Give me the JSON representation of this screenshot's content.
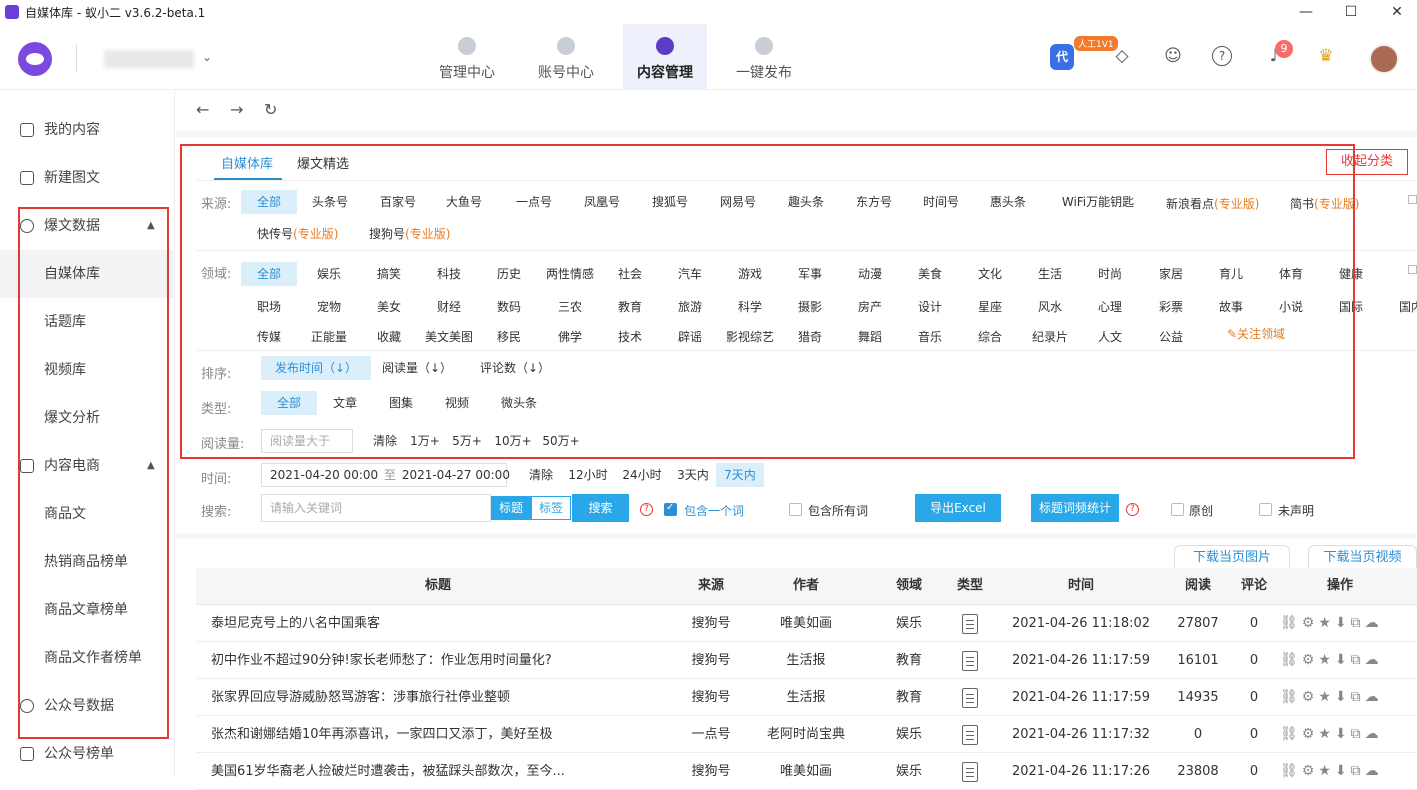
{
  "window": {
    "title": "自媒体库 - 蚁小二 v3.6.2-beta.1",
    "minimize": "—",
    "maximize": "☐",
    "close": "✕"
  },
  "header": {
    "nav": [
      {
        "label": "管理中心",
        "icon": "monitor-icon"
      },
      {
        "label": "账号中心",
        "icon": "account-icon"
      },
      {
        "label": "内容管理",
        "icon": "content-icon",
        "active": true
      },
      {
        "label": "一键发布",
        "icon": "publish-icon"
      }
    ],
    "vip_label": "代",
    "vip_tag": "人工1V1",
    "notif_count": "9",
    "icons": {
      "tag": "◇",
      "robot": "☺",
      "help": "?",
      "bell": "♪",
      "crown": "♛"
    }
  },
  "sidebar": {
    "items": [
      {
        "label": "我的内容",
        "icon": "document-icon"
      },
      {
        "label": "新建图文",
        "icon": "new-post-icon"
      },
      {
        "label": "爆文数据",
        "icon": "fire-icon",
        "expanded": true,
        "arrow": "▲"
      },
      {
        "label": "自媒体库",
        "active": true
      },
      {
        "label": "话题库"
      },
      {
        "label": "视频库"
      },
      {
        "label": "爆文分析"
      },
      {
        "label": "内容电商",
        "icon": "shop-icon",
        "expanded": true,
        "arrow": "▲"
      },
      {
        "label": "商品文"
      },
      {
        "label": "热销商品榜单"
      },
      {
        "label": "商品文章榜单"
      },
      {
        "label": "商品文作者榜单"
      },
      {
        "label": "公众号数据",
        "icon": "wechat-icon"
      },
      {
        "label": "公众号榜单",
        "icon": "trophy-icon"
      }
    ]
  },
  "toolbar": {
    "back": "←",
    "forward": "→",
    "refresh": "↻"
  },
  "filters": {
    "tabs": [
      "自媒体库",
      "爆文精选"
    ],
    "collapse_button": "收起分类",
    "source_label": "来源:",
    "sources_row1": [
      "全部",
      "头条号",
      "百家号",
      "大鱼号",
      "一点号",
      "凤凰号",
      "搜狐号",
      "网易号",
      "趣头条",
      "东方号",
      "时间号",
      "惠头条",
      "WiFi万能钥匙"
    ],
    "sources_pro": [
      {
        "name": "新浪看点",
        "tag": "(专业版)"
      },
      {
        "name": "简书",
        "tag": "(专业版)"
      },
      {
        "name": "快传号",
        "tag": "(专业版)"
      },
      {
        "name": "搜狗号",
        "tag": "(专业版)"
      }
    ],
    "field_label": "领域:",
    "fields_row1": [
      "全部",
      "娱乐",
      "搞笑",
      "科技",
      "历史",
      "两性情感",
      "社会",
      "汽车",
      "游戏",
      "军事",
      "动漫",
      "美食",
      "文化",
      "生活",
      "时尚",
      "家居",
      "育儿",
      "体育",
      "健康"
    ],
    "fields_row2": [
      "职场",
      "宠物",
      "美女",
      "财经",
      "数码",
      "三农",
      "教育",
      "旅游",
      "科学",
      "摄影",
      "房产",
      "设计",
      "星座",
      "风水",
      "心理",
      "彩票",
      "故事",
      "小说",
      "国际",
      "国内"
    ],
    "fields_row3": [
      "传媒",
      "正能量",
      "收藏",
      "美文美图",
      "移民",
      "佛学",
      "技术",
      "辟谣",
      "影视综艺",
      "猎奇",
      "舞蹈",
      "音乐",
      "综合",
      "纪录片",
      "人文",
      "公益"
    ],
    "follow_field": "✎关注领域",
    "sort_label": "排序:",
    "sorts": [
      "发布时间（↓）",
      "阅读量（↓）",
      "评论数（↓）"
    ],
    "type_label": "类型:",
    "types": [
      "全部",
      "文章",
      "图集",
      "视频",
      "微头条"
    ],
    "reads_label": "阅读量:",
    "reads_placeholder": "阅读量大于",
    "reads_opts": [
      "清除",
      "1万+",
      "5万+",
      "10万+",
      "50万+"
    ],
    "time_label": "时间:",
    "date_from": "2021-04-20 00:00",
    "date_to_sep": "至",
    "date_to": "2021-04-27 00:00",
    "time_opts": [
      "清除",
      "12小时",
      "24小时",
      "3天内",
      "7天内"
    ],
    "search_label": "搜索:",
    "search_placeholder": "请输入关键词",
    "search_scope": [
      "标题",
      "标签"
    ],
    "search_button": "搜索",
    "check_one": "包含一个词",
    "check_all": "包含所有词",
    "export_button": "导出Excel",
    "freq_button": "标题词频统计",
    "original": "原创",
    "undeclared": "未声明",
    "download_images": "下载当页图片",
    "download_videos": "下载当页视频"
  },
  "table": {
    "headers": [
      "标题",
      "来源",
      "作者",
      "领域",
      "类型",
      "时间",
      "阅读",
      "评论",
      "操作"
    ],
    "rows": [
      {
        "title": "泰坦尼克号上的八名中国乘客",
        "source": "搜狗号",
        "author": "唯美如画",
        "field": "娱乐",
        "time": "2021-04-26 11:18:02",
        "reads": "27807",
        "comments": "0"
      },
      {
        "title": "初中作业不超过90分钟!家长老师愁了：作业怎用时间量化?",
        "source": "搜狗号",
        "author": "生活报",
        "field": "教育",
        "time": "2021-04-26 11:17:59",
        "reads": "16101",
        "comments": "0"
      },
      {
        "title": "张家界回应导游威胁怒骂游客：涉事旅行社停业整顿",
        "source": "搜狗号",
        "author": "生活报",
        "field": "教育",
        "time": "2021-04-26 11:17:59",
        "reads": "14935",
        "comments": "0"
      },
      {
        "title": "张杰和谢娜结婚10年再添喜讯，一家四口又添丁，美好至极",
        "source": "一点号",
        "author": "老阿时尚宝典",
        "field": "娱乐",
        "time": "2021-04-26 11:17:32",
        "reads": "0",
        "comments": "0"
      },
      {
        "title": "美国61岁华裔老人捡破烂时遭袭击，被猛踩头部数次，至今...",
        "source": "搜狗号",
        "author": "唯美如画",
        "field": "娱乐",
        "time": "2021-04-26 11:17:26",
        "reads": "23808",
        "comments": "0"
      }
    ],
    "op_icons": "⛓⚙★⬇⧉☁"
  },
  "colors": {
    "accent": "#2b8fd6",
    "highlight_box": "#e53935",
    "brand": "#6b3fd6"
  }
}
